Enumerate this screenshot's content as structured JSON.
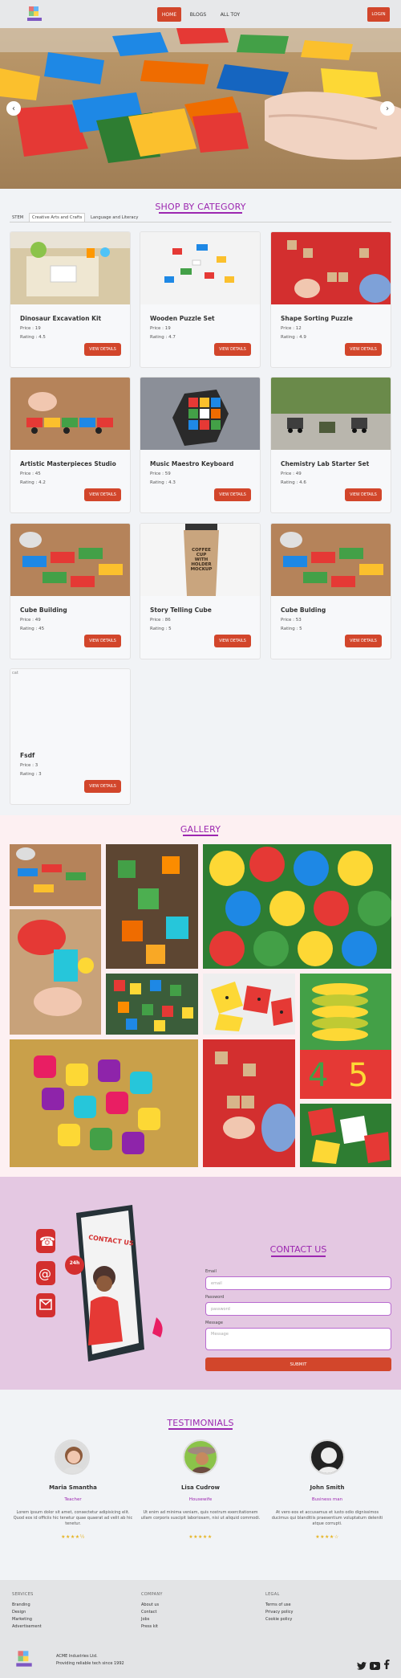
{
  "nav": {
    "items": [
      "HOME",
      "BLOGS",
      "ALL TOY"
    ],
    "login": "LOGIN"
  },
  "hero": {
    "prev": "‹",
    "next": "›"
  },
  "shop": {
    "title": "SHOP BY CATEGORY",
    "tabs": [
      "STEM",
      "Creative Arts and Crafts",
      "Language and Literacy"
    ],
    "selected_tab": "Creative Arts and Crafts",
    "button_label": "VIEW DETAILS",
    "products": [
      {
        "name": "Dinosaur Excavation Kit",
        "price": "Price : 19",
        "rating": "Rating : 4.5"
      },
      {
        "name": "Wooden Puzzle Set",
        "price": "Price : 19",
        "rating": "Rating : 4.7"
      },
      {
        "name": "Shape Sorting Puzzle",
        "price": "Price : 12",
        "rating": "Rating : 4.9"
      },
      {
        "name": "Artistic Masterpieces Studio",
        "price": "Price : 45",
        "rating": "Rating : 4.2"
      },
      {
        "name": "Music Maestro Keyboard",
        "price": "Price : 59",
        "rating": "Rating : 4.3"
      },
      {
        "name": "Chemistry Lab Starter Set",
        "price": "Price : 49",
        "rating": "Rating : 4.6"
      },
      {
        "name": "Cube Building",
        "price": "Price : 49",
        "rating": "Rating : 45"
      },
      {
        "name": "Story Telling Cube",
        "price": "Price : 86",
        "rating": "Rating : 5"
      },
      {
        "name": "Cube Bulding",
        "price": "Price : 53",
        "rating": "Rating : 5"
      },
      {
        "name": "Fsdf",
        "price": "Price : 3",
        "rating": "Rating : 3",
        "broken_image_alt": "cat"
      }
    ],
    "mug_text": "COFFEE CUP WITH HOLDER MOCKUP"
  },
  "gallery": {
    "title": "GALLERY"
  },
  "contact": {
    "title": "CONTACT US",
    "illustration_text": "CONTACT US",
    "badge": "24h",
    "email_label": "Email",
    "email_placeholder": "email",
    "password_label": "Password",
    "password_placeholder": "password",
    "message_label": "Message",
    "message_placeholder": "Message",
    "submit": "SUBMIT"
  },
  "testimonials": {
    "title": "TESTIMONIALS",
    "items": [
      {
        "name": "Maria Smantha",
        "role": "Teacher",
        "text": "Lorem ipsum dolor sit amet, consectetur adipisicing elit. Quod eos id officiis hic tenetur quae quaerat ad velit ab hic tenetur.",
        "stars": "★★★★½"
      },
      {
        "name": "Lisa Cudrow",
        "role": "Housewife",
        "text": "Ut enim ad minima veniam, quis nostrum exercitationem ullam corporis suscipit laboriosam, nisi ut aliquid commodi.",
        "stars": "★★★★★"
      },
      {
        "name": "John Smith",
        "role": "Business man",
        "text": "At vero eos et accusamus et iusto odio dignissimos ducimus qui blanditiis praesentium voluptatum deleniti atque corrupti.",
        "stars": "★★★★☆"
      }
    ]
  },
  "footer": {
    "services": {
      "title": "SERVICES",
      "links": [
        "Branding",
        "Design",
        "Marketing",
        "Advertisement"
      ]
    },
    "company": {
      "title": "COMPANY",
      "links": [
        "About us",
        "Contact",
        "Jobs",
        "Press kit"
      ]
    },
    "legal": {
      "title": "LEGAL",
      "links": [
        "Terms of use",
        "Privacy policy",
        "Cookie policy"
      ]
    },
    "company_name": "ACME Industries Ltd.",
    "tagline": "Providing reliable tech since 1992"
  },
  "colors": {
    "accent": "#d2462b",
    "purple": "#9c27b0"
  }
}
